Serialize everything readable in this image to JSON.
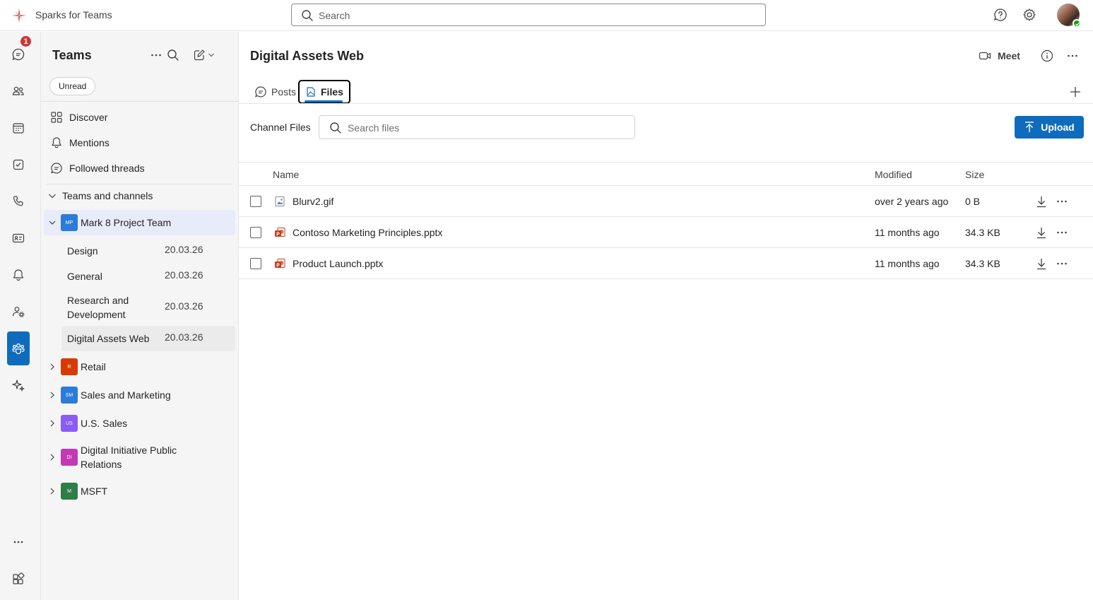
{
  "app": {
    "title": "Sparks for Teams"
  },
  "topbar": {
    "search_placeholder": "Search"
  },
  "rail": {
    "chat_badge": "1"
  },
  "panel": {
    "title": "Teams",
    "filter_pill": "Unread",
    "nav": [
      {
        "label": "Discover",
        "icon": "grid-icon"
      },
      {
        "label": "Mentions",
        "icon": "bell-icon"
      },
      {
        "label": "Followed threads",
        "icon": "chat-bubble-icon"
      }
    ],
    "section_label": "Teams and channels",
    "teams": [
      {
        "name": "Mark 8 Project Team",
        "initials": "MP",
        "color": "#2b7bd9",
        "expanded": true,
        "channels": [
          {
            "name": "Design",
            "date": "20.03.26"
          },
          {
            "name": "General",
            "date": "20.03.26"
          },
          {
            "name": "Research and Development",
            "date": "20.03.26"
          },
          {
            "name": "Digital Assets Web",
            "date": "20.03.26"
          }
        ]
      },
      {
        "name": "Retail",
        "initials": "R",
        "color": "#d83b01"
      },
      {
        "name": "Sales and Marketing",
        "initials": "SM",
        "color": "#2b7bd9"
      },
      {
        "name": "U.S. Sales",
        "initials": "US",
        "color": "#8a5cf6"
      },
      {
        "name": "Digital Initiative Public Relations",
        "initials": "DI",
        "color": "#c239b3"
      },
      {
        "name": "MSFT",
        "initials": "M",
        "color": "#2e7d46"
      }
    ]
  },
  "main": {
    "channel_title": "Digital Assets Web",
    "meet_label": "Meet",
    "tabs": [
      {
        "label": "Posts"
      },
      {
        "label": "Files"
      }
    ],
    "files_label": "Channel Files",
    "files_search_placeholder": "Search files",
    "upload_label": "Upload",
    "columns": {
      "name": "Name",
      "modified": "Modified",
      "size": "Size"
    },
    "files": [
      {
        "name": "Blurv2.gif",
        "modified": "over 2 years ago",
        "size": "0 B",
        "type": "image-file-icon"
      },
      {
        "name": "Contoso Marketing Principles.pptx",
        "modified": "11 months ago",
        "size": "34.3 KB",
        "type": "powerpoint-file-icon"
      },
      {
        "name": "Product Launch.pptx",
        "modified": "11 months ago",
        "size": "34.3 KB",
        "type": "powerpoint-file-icon"
      }
    ]
  }
}
